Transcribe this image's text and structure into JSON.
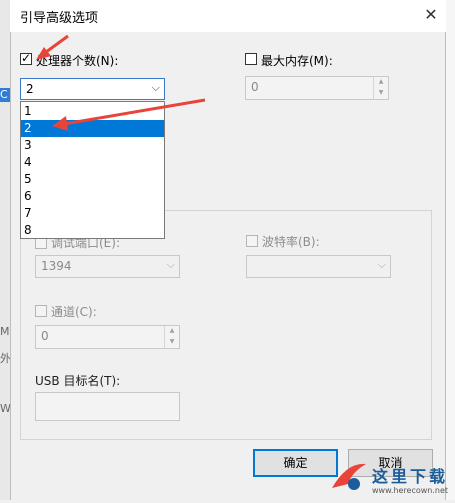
{
  "dialog": {
    "title": "引导高级选项",
    "close_icon": "close-icon"
  },
  "processors": {
    "label": "处理器个数(N):",
    "checked": true,
    "selected": "2",
    "options": [
      "1",
      "2",
      "3",
      "4",
      "5",
      "6",
      "7",
      "8"
    ]
  },
  "max_memory": {
    "label": "最大内存(M):",
    "checked": false,
    "value": "0"
  },
  "debug": {
    "port_label": "调试端口(E):",
    "port_value": "1394",
    "baud_label": "波特率(B):",
    "baud_value": "",
    "channel_label": "通道(C):",
    "channel_value": "0",
    "usb_label": "USB 目标名(T):",
    "usb_value": ""
  },
  "buttons": {
    "ok": "确定",
    "cancel": "取消"
  },
  "background_window": {
    "letters": [
      "C",
      "M",
      "外",
      "W"
    ]
  },
  "watermark": {
    "text": "这里下载",
    "url": "www.herecown.net"
  },
  "colors": {
    "accent": "#0078d7",
    "arrow": "#e8443a"
  }
}
